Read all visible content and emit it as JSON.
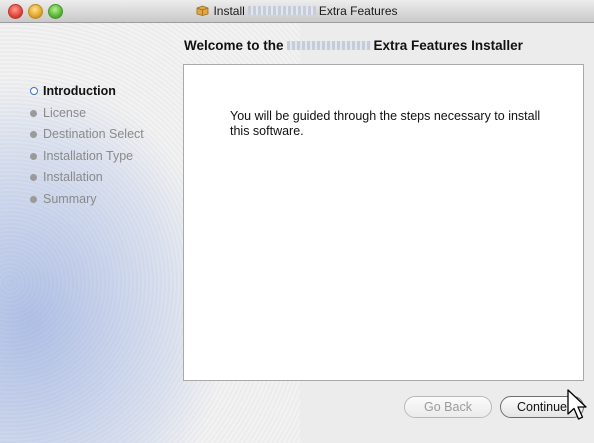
{
  "window": {
    "title_prefix": "Install",
    "title_suffix": "Extra Features"
  },
  "header": {
    "title_prefix": "Welcome to the",
    "title_suffix": "Extra Features Installer"
  },
  "steps": [
    {
      "label": "Introduction",
      "active": true
    },
    {
      "label": "License",
      "active": false
    },
    {
      "label": "Destination Select",
      "active": false
    },
    {
      "label": "Installation Type",
      "active": false
    },
    {
      "label": "Installation",
      "active": false
    },
    {
      "label": "Summary",
      "active": false
    }
  ],
  "content": {
    "intro_text": "You will be guided through the steps necessary to install this software."
  },
  "buttons": {
    "back_label": "Go Back",
    "continue_label": "Continue"
  }
}
